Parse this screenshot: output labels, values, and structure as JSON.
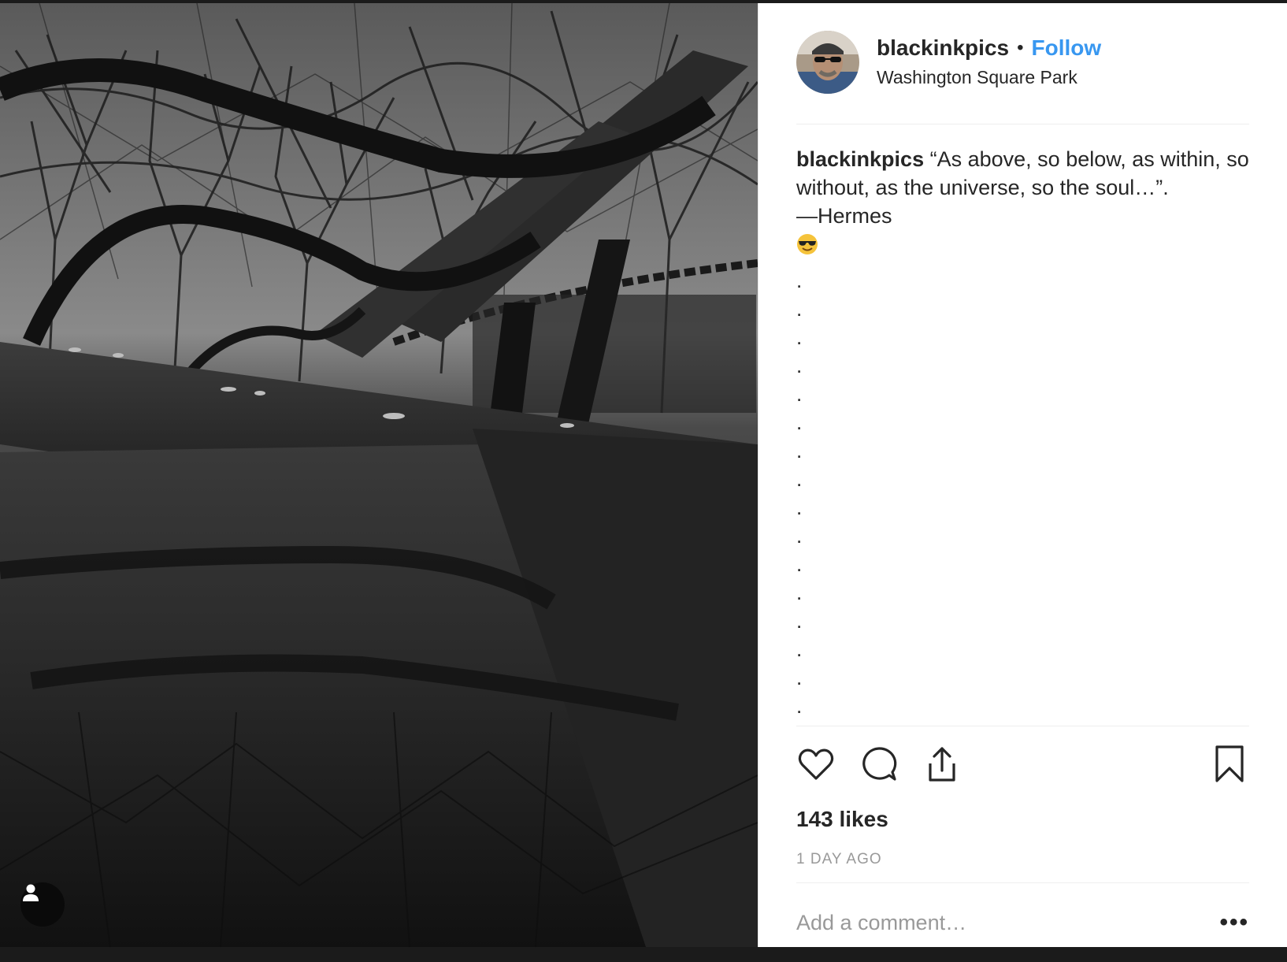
{
  "post": {
    "username": "blackinkpics",
    "separator": "•",
    "follow_label": "Follow",
    "location": "Washington Square Park",
    "caption": {
      "username": "blackinkpics",
      "text": "“As above, so below, as within, so without, as the universe, so the soul…”.",
      "attribution": "—Hermes",
      "emoji": "😎",
      "dots": [
        ".",
        ".",
        ".",
        ".",
        ".",
        ".",
        ".",
        ".",
        ".",
        ".",
        ".",
        ".",
        ".",
        ".",
        ".",
        "."
      ]
    },
    "likes": "143 likes",
    "time": "1 DAY AGO",
    "comment_placeholder": "Add a comment…",
    "more_label": "•••"
  },
  "colors": {
    "follow": "#3897f0",
    "text": "#262626",
    "muted": "#999999"
  },
  "icons": [
    "user-tag-icon",
    "heart-icon",
    "comment-icon",
    "share-icon",
    "bookmark-icon"
  ]
}
